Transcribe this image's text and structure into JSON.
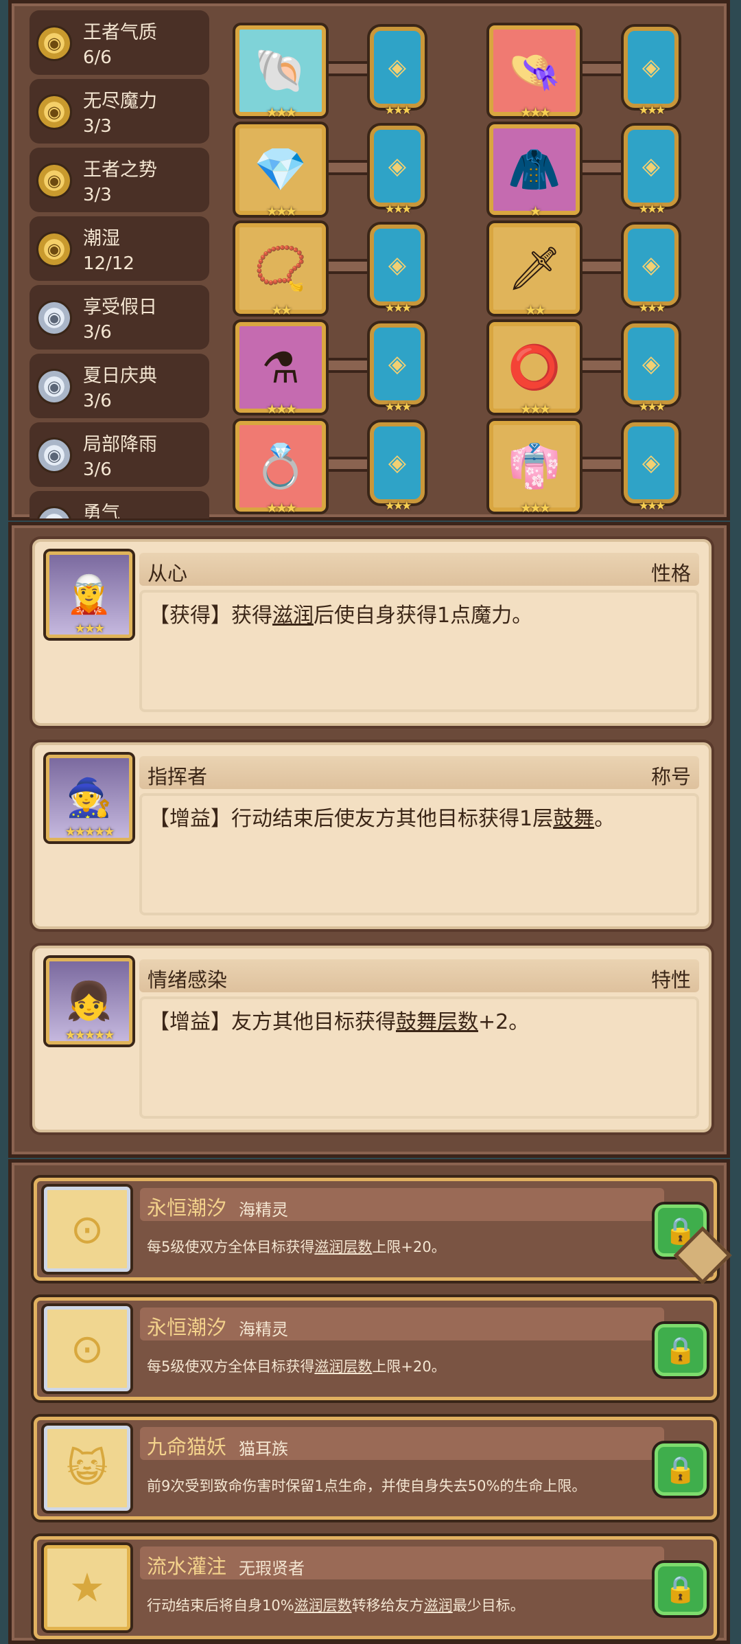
{
  "traits": [
    {
      "name": "王者气质",
      "count": "6/6",
      "tier": "gold"
    },
    {
      "name": "无尽魔力",
      "count": "3/3",
      "tier": "gold"
    },
    {
      "name": "王者之势",
      "count": "3/3",
      "tier": "gold"
    },
    {
      "name": "潮湿",
      "count": "12/12",
      "tier": "gold"
    },
    {
      "name": "享受假日",
      "count": "3/6",
      "tier": "silver"
    },
    {
      "name": "夏日庆典",
      "count": "3/6",
      "tier": "silver"
    },
    {
      "name": "局部降雨",
      "count": "3/6",
      "tier": "silver"
    },
    {
      "name": "勇气",
      "count": "",
      "tier": "silver"
    }
  ],
  "relics": [
    {
      "icon": "shell-horn-icon",
      "emoji": "🐚",
      "stars": "★★★",
      "bg": "#7fd3d8",
      "rune_color": "#2fa3c7",
      "rune_stars": "★★★"
    },
    {
      "icon": "straw-hat-icon",
      "emoji": "👒",
      "stars": "★★★",
      "bg": "#f07a72",
      "rune_color": "#2fa3c7",
      "rune_stars": "★★★"
    },
    {
      "icon": "crystal-star-icon",
      "emoji": "💎",
      "stars": "★★★",
      "bg": "#e0b45a",
      "rune_color": "#2fa3c7",
      "rune_stars": "★★★"
    },
    {
      "icon": "cloak-icon",
      "emoji": "🧥",
      "stars": "★",
      "bg": "#c56bb0",
      "rune_color": "#2fa3c7",
      "rune_stars": "★★★"
    },
    {
      "icon": "necklace-icon",
      "emoji": "📿",
      "stars": "★★",
      "bg": "#e0b45a",
      "rune_color": "#2fa3c7",
      "rune_stars": "★★★"
    },
    {
      "icon": "sword-hilt-icon",
      "emoji": "🗡",
      "stars": "★★",
      "bg": "#e0b45a",
      "rune_color": "#2fa3c7",
      "rune_stars": "★★★"
    },
    {
      "icon": "potion-icon",
      "emoji": "⚗",
      "stars": "★★★",
      "bg": "#c56bb0",
      "rune_color": "#2fa3c7",
      "rune_stars": "★★★"
    },
    {
      "icon": "dark-ring-icon",
      "emoji": "⭕",
      "stars": "★★★",
      "bg": "#e0b45a",
      "rune_color": "#2fa3c7",
      "rune_stars": "★★★"
    },
    {
      "icon": "gold-ring-icon",
      "emoji": "💍",
      "stars": "★★★",
      "bg": "#f07a72",
      "rune_color": "#2fa3c7",
      "rune_stars": "★★★"
    },
    {
      "icon": "jester-robe-icon",
      "emoji": "👘",
      "stars": "★★★",
      "bg": "#e0b45a",
      "rune_color": "#2fa3c7",
      "rune_stars": "★★★"
    }
  ],
  "skills": [
    {
      "name": "从心",
      "type": "性格",
      "stars": "★★★",
      "emoji": "🧝",
      "desc_pre": "【获得】获得",
      "desc_link": "滋润",
      "desc_post": "后使自身获得1点魔力。"
    },
    {
      "name": "指挥者",
      "type": "称号",
      "stars": "★★★★★",
      "emoji": "🧙",
      "desc_pre": "【增益】行动结束后使友方其他目标获得1层",
      "desc_link": "鼓舞",
      "desc_post": "。"
    },
    {
      "name": "情绪感染",
      "type": "特性",
      "stars": "★★★★★",
      "emoji": "👧",
      "desc_pre": "【增益】友方其他目标获得",
      "desc_link": "鼓舞层数",
      "desc_post": "+2。"
    }
  ],
  "bonds": [
    {
      "name": "永恒潮汐",
      "race": "海精灵",
      "desc_pre": "每5级使双方全体目标获得",
      "desc_link": "滋润层数",
      "desc_post": "上限+20。",
      "glyph": "⊙",
      "tier": "silver",
      "icon": "tide-emblem-icon"
    },
    {
      "name": "永恒潮汐",
      "race": "海精灵",
      "desc_pre": "每5级使双方全体目标获得",
      "desc_link": "滋润层数",
      "desc_post": "上限+20。",
      "glyph": "⊙",
      "tier": "silver",
      "icon": "tide-emblem-icon"
    },
    {
      "name": "九命猫妖",
      "race": "猫耳族",
      "desc_pre": "前9次受到致命伤害时保留1点生命，并使自身失去50%的生命上限。",
      "desc_link": "",
      "desc_post": "",
      "glyph": "😺",
      "tier": "silver",
      "icon": "cat-face-icon"
    },
    {
      "name": "流水灌注",
      "race": "无瑕贤者",
      "desc_pre": "行动结束后将自身10%",
      "desc_link": "滋润层数",
      "desc_post": "转移给友方",
      "desc_link2": "滋润",
      "desc_post2": "最少目标。",
      "glyph": "★",
      "tier": "gold",
      "icon": "star-emblem-icon"
    }
  ],
  "lock_icon": "🔒"
}
